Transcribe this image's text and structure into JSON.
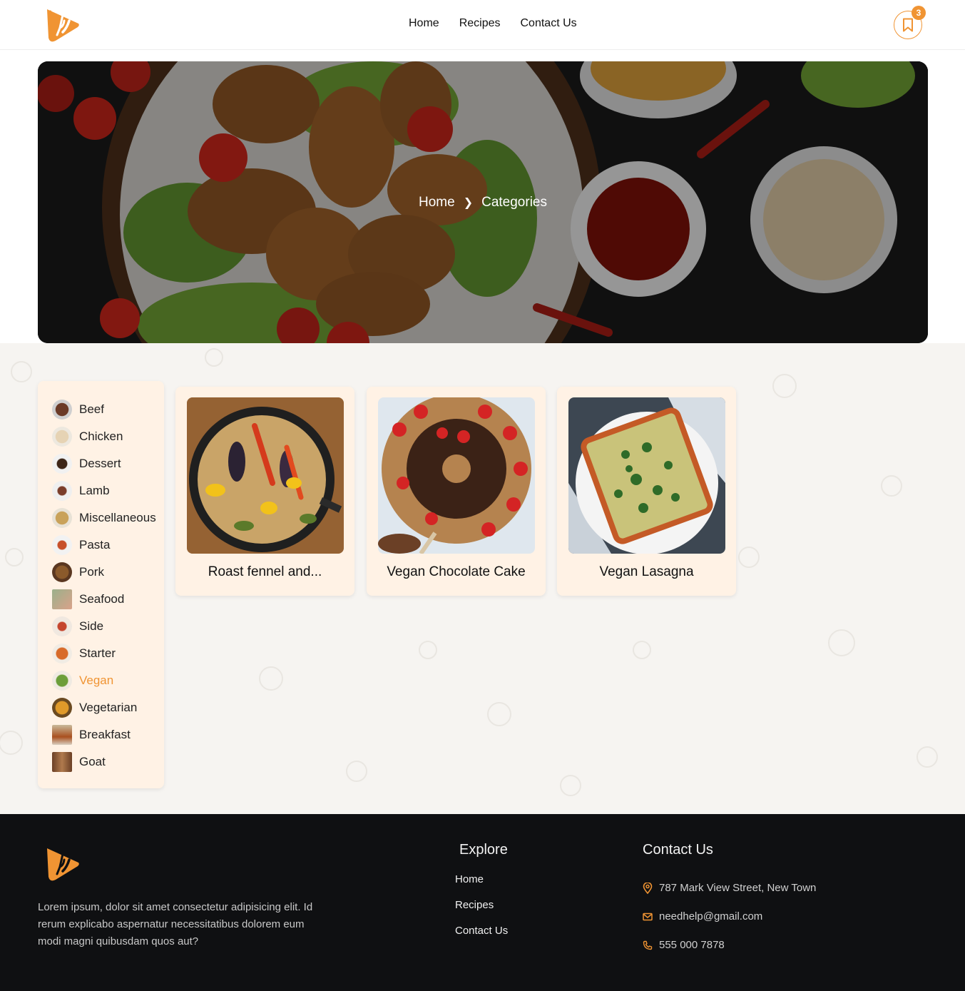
{
  "header": {
    "nav": [
      "Home",
      "Recipes",
      "Contact Us"
    ],
    "bookmark_count": "3"
  },
  "hero": {
    "breadcrumb": [
      "Home",
      "Categories"
    ]
  },
  "sidebar": {
    "categories": [
      "Beef",
      "Chicken",
      "Dessert",
      "Lamb",
      "Miscellaneous",
      "Pasta",
      "Pork",
      "Seafood",
      "Side",
      "Starter",
      "Vegan",
      "Vegetarian",
      "Breakfast",
      "Goat"
    ],
    "active": "Vegan"
  },
  "recipes": [
    {
      "title": "Roast fennel and..."
    },
    {
      "title": "Vegan Chocolate Cake"
    },
    {
      "title": "Vegan Lasagna"
    }
  ],
  "footer": {
    "description": "Lorem ipsum, dolor sit amet consectetur adipisicing elit. Id rerum explicabo aspernatur necessitatibus dolorem eum modi magni quibusdam quos aut?",
    "explore_heading": "Explore",
    "explore_links": [
      "Home",
      "Recipes",
      "Contact Us"
    ],
    "contact_heading": "Contact Us",
    "address": "787 Mark View Street, New Town",
    "email": "needhelp@gmail.com",
    "phone": "555 000 7878"
  },
  "colors": {
    "accent": "#f09433",
    "card_bg": "#fff2e5",
    "footer_bg": "#0f1012"
  }
}
